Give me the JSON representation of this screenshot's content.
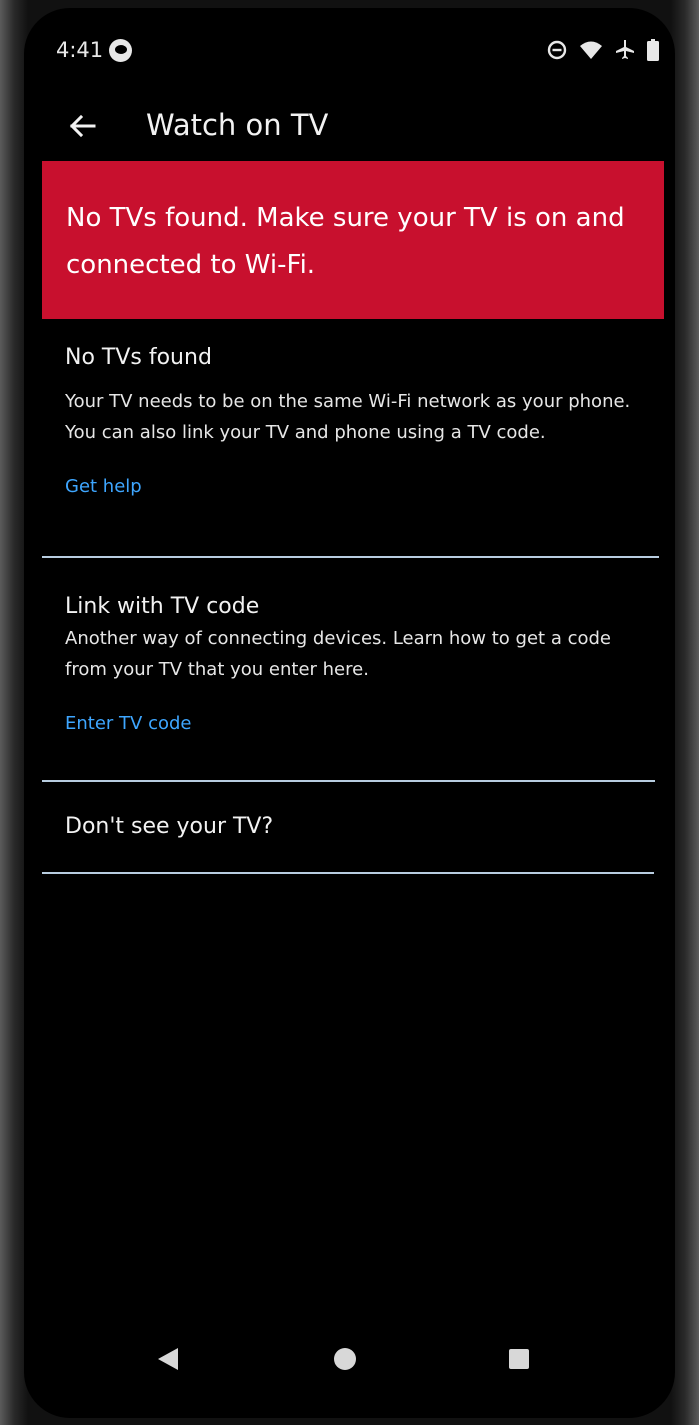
{
  "status_bar": {
    "time": "4:41",
    "icons": [
      "app-notification-icon",
      "do-not-disturb-icon",
      "wifi-icon",
      "airplane-mode-icon",
      "battery-icon"
    ]
  },
  "header": {
    "title": "Watch on TV",
    "back_icon": "arrow-left-icon"
  },
  "error_banner": {
    "text": "No TVs found. Make sure your TV is on and connected to Wi-Fi.",
    "color": "#c8102e"
  },
  "sections": {
    "no_tvs": {
      "title": "No TVs found",
      "body": "Your TV needs to be on the same Wi-Fi network as your phone. You can also link your TV and phone using a TV code.",
      "link": "Get help"
    },
    "tv_code": {
      "title": "Link with TV code",
      "body": "Another way of connecting devices. Learn how to get a code from your TV that you enter here.",
      "link": "Enter TV code"
    },
    "dont_see": {
      "title": "Don't see your TV?"
    }
  },
  "colors": {
    "link": "#3ea6ff",
    "background": "#000000",
    "divider": "#b8cde0"
  },
  "nav_bar": {
    "icons": [
      "nav-back-icon",
      "nav-home-icon",
      "nav-recents-icon"
    ]
  }
}
